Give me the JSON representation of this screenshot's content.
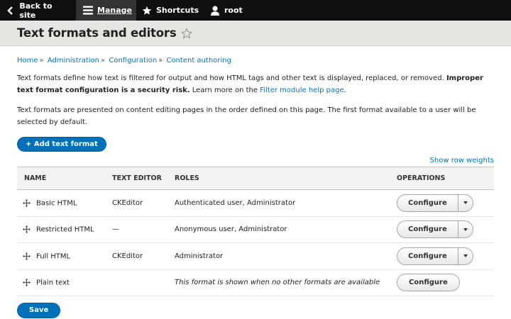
{
  "toolbar": {
    "back_label": "Back to site",
    "manage_label": "Manage",
    "shortcuts_label": "Shortcuts",
    "user_label": "root"
  },
  "header": {
    "title": "Text formats and editors"
  },
  "breadcrumb": [
    "Home",
    "Administration",
    "Configuration",
    "Content authoring"
  ],
  "intro": {
    "text1": "Text formats define how text is filtered for output and how HTML tags and other text is displayed, replaced, or removed.",
    "warning": "Improper text format configuration is a security risk.",
    "text2": "Learn more on the",
    "link": "Filter module help page",
    "text3": ".",
    "para2": "Text formats are presented on content editing pages in the order defined on this page. The first format available to a user will be selected by default."
  },
  "add_button": "+ Add text format",
  "row_weights_link": "Show row weights",
  "table": {
    "headers": [
      "NAME",
      "TEXT EDITOR",
      "ROLES",
      "OPERATIONS"
    ],
    "rows": [
      {
        "name": "Basic HTML",
        "editor": "CKEditor",
        "roles": "Authenticated user, Administrator",
        "op": "Configure",
        "dropdown": true,
        "roles_italic": false
      },
      {
        "name": "Restricted HTML",
        "editor": "—",
        "roles": "Anonymous user, Administrator",
        "op": "Configure",
        "dropdown": true,
        "roles_italic": false
      },
      {
        "name": "Full HTML",
        "editor": "CKEditor",
        "roles": "Administrator",
        "op": "Configure",
        "dropdown": true,
        "roles_italic": false
      },
      {
        "name": "Plain text",
        "editor": "",
        "roles": "This format is shown when no other formats are available",
        "op": "Configure",
        "dropdown": false,
        "roles_italic": true
      }
    ]
  },
  "save_button": "Save",
  "colors": {
    "link": "#0074bd",
    "primary_button": "#0071b8",
    "toolbar": "#0f0f0f"
  }
}
